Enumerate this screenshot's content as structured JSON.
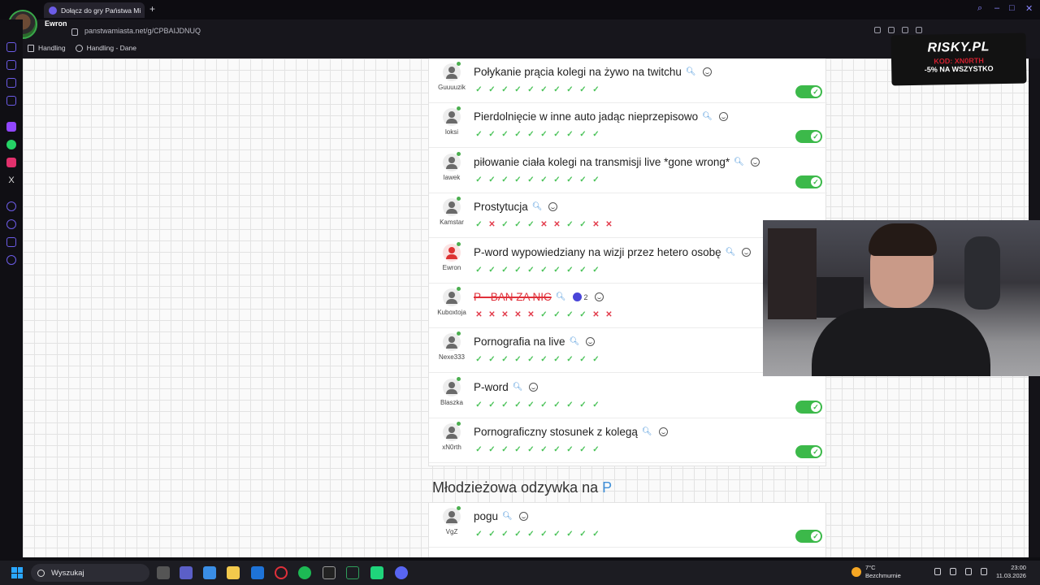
{
  "browser": {
    "tab_title": "Dołącz do gry Państwa Mi",
    "new_tab": "+",
    "profile_name": "Ewron",
    "url": "panstwamiasta.net/g/CPBAIJDNUQ",
    "bookmarks": [
      {
        "label": "Handling"
      },
      {
        "label": "Handling - Dane"
      }
    ]
  },
  "rows": [
    {
      "user": "Guuuuzik",
      "answer": "Połykanie prącia kolegi na żywo na twitchu",
      "votes": [
        "ok",
        "ok",
        "ok",
        "ok",
        "ok",
        "ok",
        "ok",
        "ok",
        "ok",
        "ok"
      ],
      "toggle": true
    },
    {
      "user": "loksi",
      "answer": "Pierdolnięcie w inne auto jadąc nieprzepisowo",
      "votes": [
        "ok",
        "ok",
        "ok",
        "ok",
        "ok",
        "ok",
        "ok",
        "ok",
        "ok",
        "ok"
      ],
      "toggle": true
    },
    {
      "user": "lawek",
      "answer": "piłowanie ciała kolegi na transmisji live *gone wrong*",
      "votes": [
        "ok",
        "ok",
        "ok",
        "ok",
        "ok",
        "ok",
        "ok",
        "ok",
        "ok",
        "ok"
      ],
      "toggle": true
    },
    {
      "user": "Kamstar",
      "answer": "Prostytucja",
      "votes": [
        "ok",
        "no",
        "ok",
        "ok",
        "ok",
        "no",
        "no",
        "ok",
        "ok",
        "no",
        "no"
      ],
      "toggle": false
    },
    {
      "user": "Ewron",
      "answer": "P-word wypowiedziany na wizji przez hetero osobę",
      "votes": [
        "ok",
        "ok",
        "ok",
        "ok",
        "ok",
        "ok",
        "ok",
        "ok",
        "ok",
        "ok"
      ],
      "toggle": false,
      "avatar_red": true
    },
    {
      "user": "Kuboxtoja",
      "answer": "P - BAN ZA NIC",
      "votes": [
        "no",
        "no",
        "no",
        "no",
        "no",
        "ok",
        "ok",
        "ok",
        "ok",
        "no",
        "no"
      ],
      "toggle": false,
      "struck": true,
      "likes": "2"
    },
    {
      "user": "Nexe333",
      "answer": "Pornografia na live",
      "votes": [
        "ok",
        "ok",
        "ok",
        "ok",
        "ok",
        "ok",
        "ok",
        "ok",
        "ok",
        "ok"
      ],
      "toggle": false
    },
    {
      "user": "Blaszka",
      "answer": "P-word",
      "votes": [
        "ok",
        "ok",
        "ok",
        "ok",
        "ok",
        "ok",
        "ok",
        "ok",
        "ok",
        "ok"
      ],
      "toggle": true
    },
    {
      "user": "xN0rth",
      "answer": "Pornograficzny stosunek z kolegą",
      "votes": [
        "ok",
        "ok",
        "ok",
        "ok",
        "ok",
        "ok",
        "ok",
        "ok",
        "ok",
        "ok"
      ],
      "toggle": true
    }
  ],
  "section": {
    "title": "Młodzieżowa odzywka na",
    "letter": "P"
  },
  "section_rows": [
    {
      "user": "VgZ",
      "answer": "pogu",
      "votes": [
        "ok",
        "ok",
        "ok",
        "ok",
        "ok",
        "ok",
        "ok",
        "ok",
        "ok",
        "ok"
      ],
      "toggle": true
    }
  ],
  "ad": {
    "brand": "RISKY.PL",
    "code": "KOD: XN0RTH",
    "promo": "-5% NA WSZYSTKO"
  },
  "taskbar": {
    "search": "Wyszukaj",
    "temp": "7°C",
    "weather": "Bezchmurnie",
    "time": "23:00",
    "date": "11.03.2026"
  },
  "colors": {
    "accent_blue": "#3f8fd8",
    "ok_green": "#4cc35a",
    "no_red": "#e23a4a",
    "toggle_green": "#3cb94a"
  }
}
